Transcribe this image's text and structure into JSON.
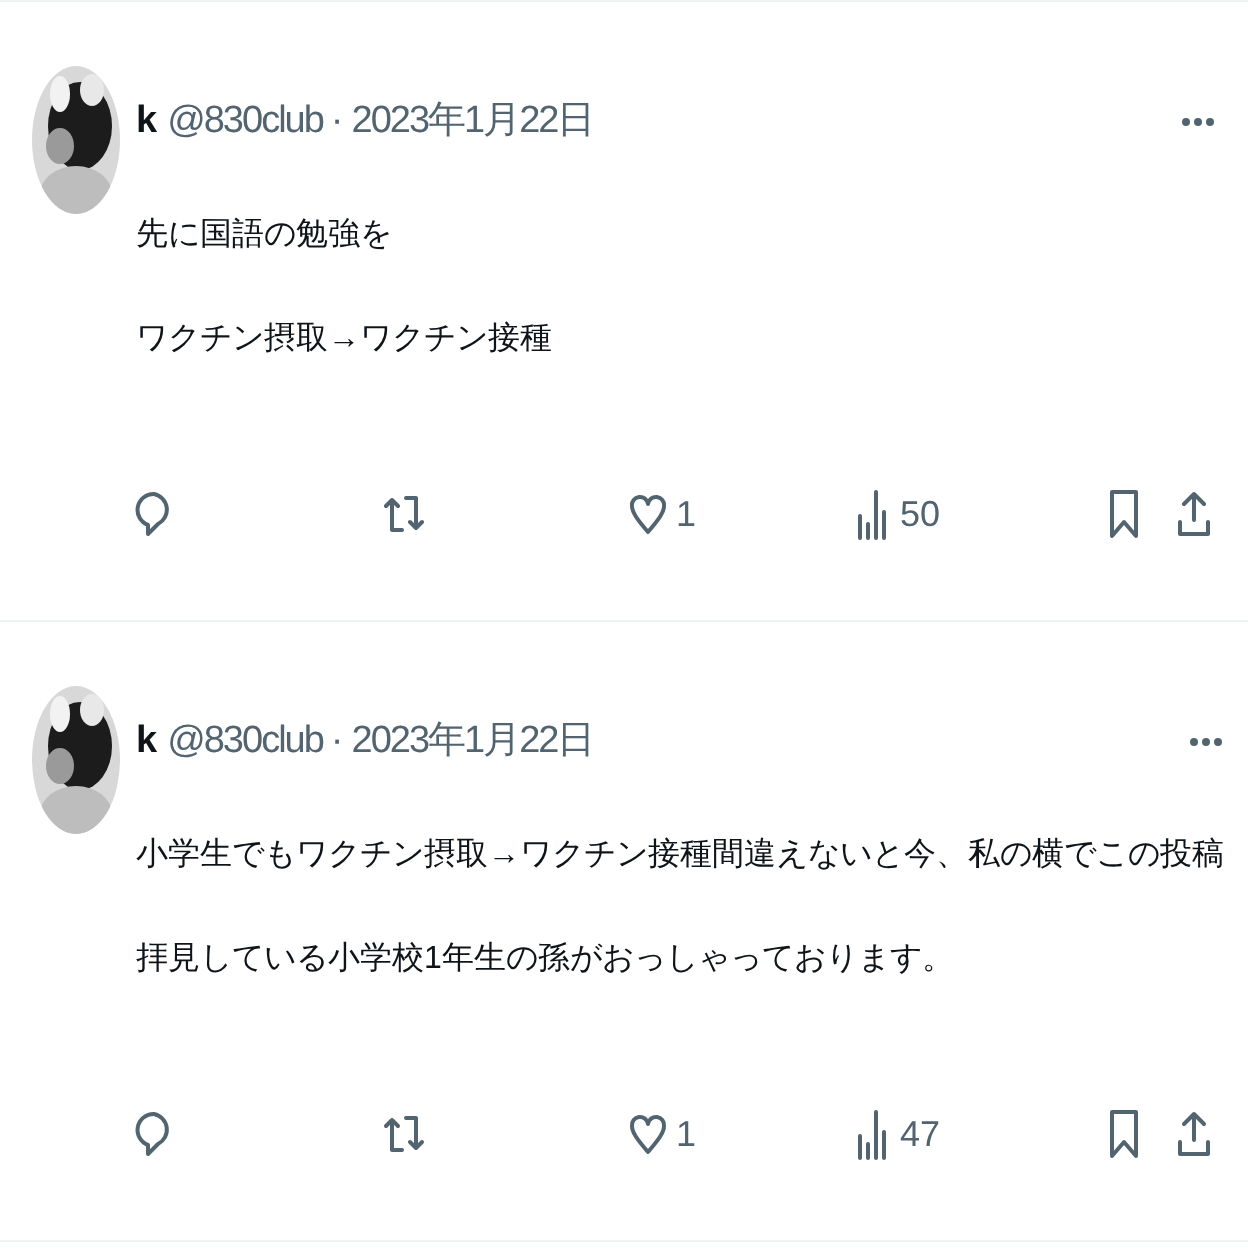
{
  "posts": [
    {
      "name": "k",
      "handle": "@830club",
      "separator": "·",
      "date": "2023年1月22日",
      "lines": [
        "先に国語の勉強を",
        "ワクチン摂取→ワクチン接種"
      ],
      "likes": "1",
      "views": "50"
    },
    {
      "name": "k",
      "handle": "@830club",
      "separator": "·",
      "date": "2023年1月22日",
      "lines": [
        "小学生でもワクチン摂取→ワクチン接種間違えないと今、私の横でこの投稿",
        "拝見している小学校1年生の孫がおっしゃっております。"
      ],
      "likes": "1",
      "views": "47"
    }
  ]
}
